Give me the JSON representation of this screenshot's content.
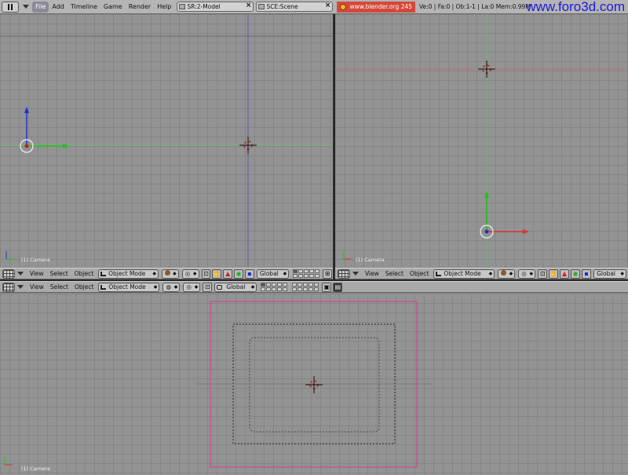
{
  "topbar": {
    "menus": [
      "File",
      "Add",
      "Timeline",
      "Game",
      "Render",
      "Help"
    ],
    "screen_field": "SR:2-Model",
    "scene_field": "SCE:Scene",
    "link": "www.blender.org 245",
    "stats": "Ve:0 | Fa:0 | Ob:1-1 | La:0   Mem:0.99M",
    "watermark": "www.foro3d.com"
  },
  "viewports": {
    "top_left": {
      "label": "(1) Camera"
    },
    "top_right": {
      "label": "(1) Camera"
    },
    "bottom": {
      "label": "(1) Camera"
    }
  },
  "header": {
    "view": "View",
    "select": "Select",
    "object": "Object",
    "mode": "Object Mode",
    "orientation": "Global"
  },
  "colors": {
    "x_axis": "#e03030",
    "y_axis": "#20c020",
    "z_axis": "#2030d0",
    "camera_frame": "#d8388f",
    "link_badge": "#d4483c",
    "watermark": "#1a1adb"
  }
}
